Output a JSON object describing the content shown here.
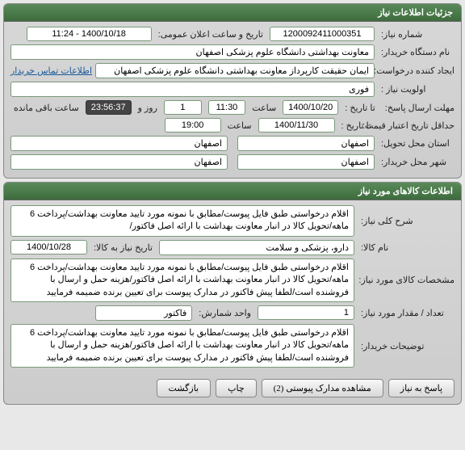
{
  "need_info": {
    "header": "جزئیات اطلاعات نیاز",
    "labels": {
      "need_no": "شماره نیاز:",
      "buyer_org": "نام دستگاه خریدار:",
      "creator": "ایجاد کننده درخواست:",
      "priority": "اولویت نیاز :",
      "deadline": "مهلت ارسال پاسخ:",
      "credit": "حداقل تاریخ اعتبار قیمت:",
      "delivery_city": "استان محل تحویل:",
      "buyer_city": "شهر محل خریدار:",
      "to_date": "تا تاریخ :",
      "pub_date": "تاریخ و ساعت اعلان عمومی:",
      "time": "ساعت",
      "day_and": "روز و",
      "remain": "ساعت باقی مانده"
    },
    "values": {
      "need_no": "1200092411000351",
      "pub_date": "1400/10/18 - 11:24",
      "buyer_org": "معاونت بهداشتی دانشگاه علوم پزشکی اصفهان",
      "creator": "ایمان حقیقت کارپرداز معاونت بهداشتی دانشگاه علوم پزشکی اصفهان",
      "priority": "فوری",
      "to_date": "1400/10/20",
      "to_time": "11:30",
      "days_remain": "1",
      "time_remain": "23:56:37",
      "credit_date": "1400/11/30",
      "credit_time": "19:00",
      "delivery_city": "اصفهان",
      "delivery_city2": "اصفهان",
      "buyer_city": "اصفهان",
      "buyer_city2": "اصفهان"
    },
    "contact_link": "اطلاعات تماس خریدار"
  },
  "goods_info": {
    "header": "اطلاعات کالاهای مورد نیاز",
    "labels": {
      "summary": "شرح کلی نیاز:",
      "goods_name": "نام کالا:",
      "need_date": "تاریخ نیاز به کالا:",
      "specs": "مشخصات کالای مورد نیاز:",
      "qty": "تعداد / مقدار مورد نیاز:",
      "unit": "واحد شمارش:",
      "buyer_notes": "توضیحات خریدار:"
    },
    "values": {
      "summary": "اقلام درخواستی طبق فایل پیوست/مطابق با نمونه مورد تایید معاونت بهداشت/پرداخت 6 ماهه/تحویل کالا در انبار معاونت بهداشت با ارائه اصل فاکتور/",
      "goods_name": "دارو، پزشکی و سلامت",
      "need_date": "1400/10/28",
      "specs": "اقلام درخواستی طبق فایل پیوست/مطابق با نمونه مورد تایید معاونت بهداشت/پرداخت 6 ماهه/تحویل کالا در انبار معاونت بهداشت با ارائه اصل فاکتور/هزینه حمل و ارسال با فروشنده است/لطفا پیش فاکتور در مدارک پیوست برای تعیین برنده ضمیمه فرمایید",
      "qty": "1",
      "unit": "فاکتور",
      "buyer_notes": "اقلام درخواستی طبق فایل پیوست/مطابق با نمونه مورد تایید معاونت بهداشت/پرداخت 6 ماهه/تحویل کالا در انبار معاونت بهداشت با ارائه اصل فاکتور/هزینه حمل و ارسال با فروشنده است/لطفا پیش فاکتور در مدارک پیوست برای تعیین برنده ضمیمه فرمایید"
    }
  },
  "buttons": {
    "reply": "پاسخ به نیاز",
    "attachments": "مشاهده مدارک پیوستی (2)",
    "print": "چاپ",
    "back": "بازگشت"
  }
}
